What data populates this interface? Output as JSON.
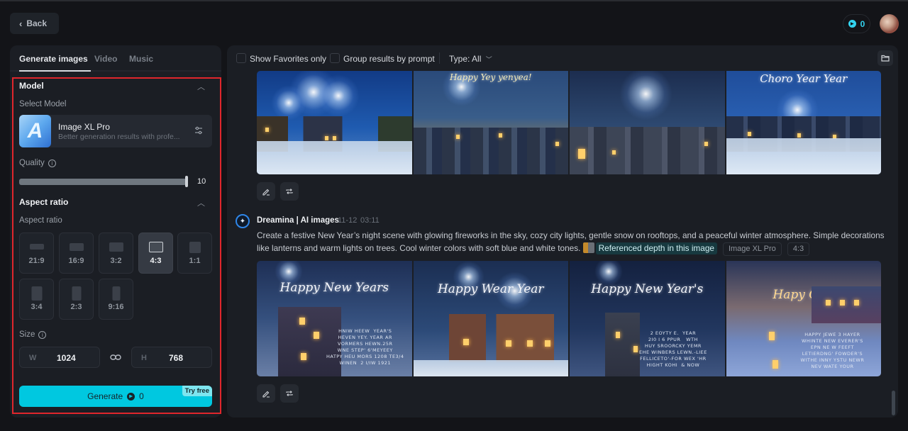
{
  "header": {
    "back_label": "Back",
    "credits": "0",
    "avatar_alt": "user-avatar"
  },
  "sidebar": {
    "tabs": [
      {
        "label": "Generate images",
        "active": true
      },
      {
        "label": "Video",
        "active": false
      },
      {
        "label": "Music",
        "active": false
      }
    ],
    "model_section": {
      "title": "Model",
      "select_label": "Select Model",
      "model_name": "Image XL Pro",
      "model_desc": "Better generation results with profe...",
      "model_icon_letter": "A"
    },
    "quality": {
      "label": "Quality",
      "value": "10",
      "fraction": 1.0
    },
    "aspect_section": {
      "title": "Aspect ratio",
      "label": "Aspect ratio",
      "options": [
        {
          "label": "21:9",
          "selected": false
        },
        {
          "label": "16:9",
          "selected": false
        },
        {
          "label": "3:2",
          "selected": false
        },
        {
          "label": "4:3",
          "selected": true
        },
        {
          "label": "1:1",
          "selected": false
        },
        {
          "label": "3:4",
          "selected": false
        },
        {
          "label": "2:3",
          "selected": false
        },
        {
          "label": "9:16",
          "selected": false
        }
      ]
    },
    "size": {
      "label": "Size",
      "w_label": "W",
      "w_value": "1024",
      "h_label": "H",
      "h_value": "768"
    },
    "generate": {
      "label": "Generate",
      "cost": "0",
      "badge": "Try free"
    }
  },
  "main": {
    "toolbar": {
      "favorites_label": "Show Favorites only",
      "group_label": "Group results by prompt",
      "type_label": "Type: All"
    },
    "first_group": {
      "images": [
        {
          "caption": ""
        },
        {
          "caption": "Happy Yey yenyea!"
        },
        {
          "caption": ""
        },
        {
          "caption": "Choro Year Year"
        }
      ]
    },
    "second_group": {
      "author": "Dreamina | AI images",
      "date": "11-12",
      "time": "03:11",
      "prompt": "Create a festive New Year’s night scene with glowing fireworks in the sky, cozy city lights, gentle snow on rooftops, and a peaceful winter atmosphere. Simple decorations like lanterns and warm lights on trees. Cool winter colors with soft blue and white tones.",
      "reference_chip": "Referenced depth in this image",
      "model_tag": "Image XL Pro",
      "ratio_tag": "4:3",
      "images": [
        {
          "caption": "Happy New Years",
          "small": "HNIW HEEW  YEAR'S\nHEVEN YEY. YEAR AR\nVORMERS HEWN.25R\nWNE STEP' 6'MEYEEY\nHATPY HEU MORS 1208 TE3/4\nWINEN  2 I/IW 1921"
        },
        {
          "caption": "Happy Wear Year",
          "small": ""
        },
        {
          "caption": "Happy New Year's",
          "small": "2 EOYTY E.  YEAR\n2I0 I 6 PPUR   WTH\nHUY SROORCKY YEMR\nEHE WINBERS LEWN.-LIEE\nFELLICETO'-FOR WEX 'HR\nHIGHT KOHI  & NOW"
        },
        {
          "caption": "Hapy  Ovit",
          "small": "HAPPY JEWE 3 HAYER\nWHINTE NEW EVERER'S\nEPN NE W FEEFT\nLETIERDNG' FOWDER'S\nWITHE INNY YSTU NEWR\nNEV WATE YOUR"
        }
      ]
    },
    "actions": {
      "edit_icon": "pencil-icon",
      "regenerate_icon": "repeat-icon"
    }
  },
  "colors": {
    "accent": "#00c8e0",
    "highlight_frame": "#e0262c",
    "background": "#131418",
    "panel": "#1b1e24"
  }
}
